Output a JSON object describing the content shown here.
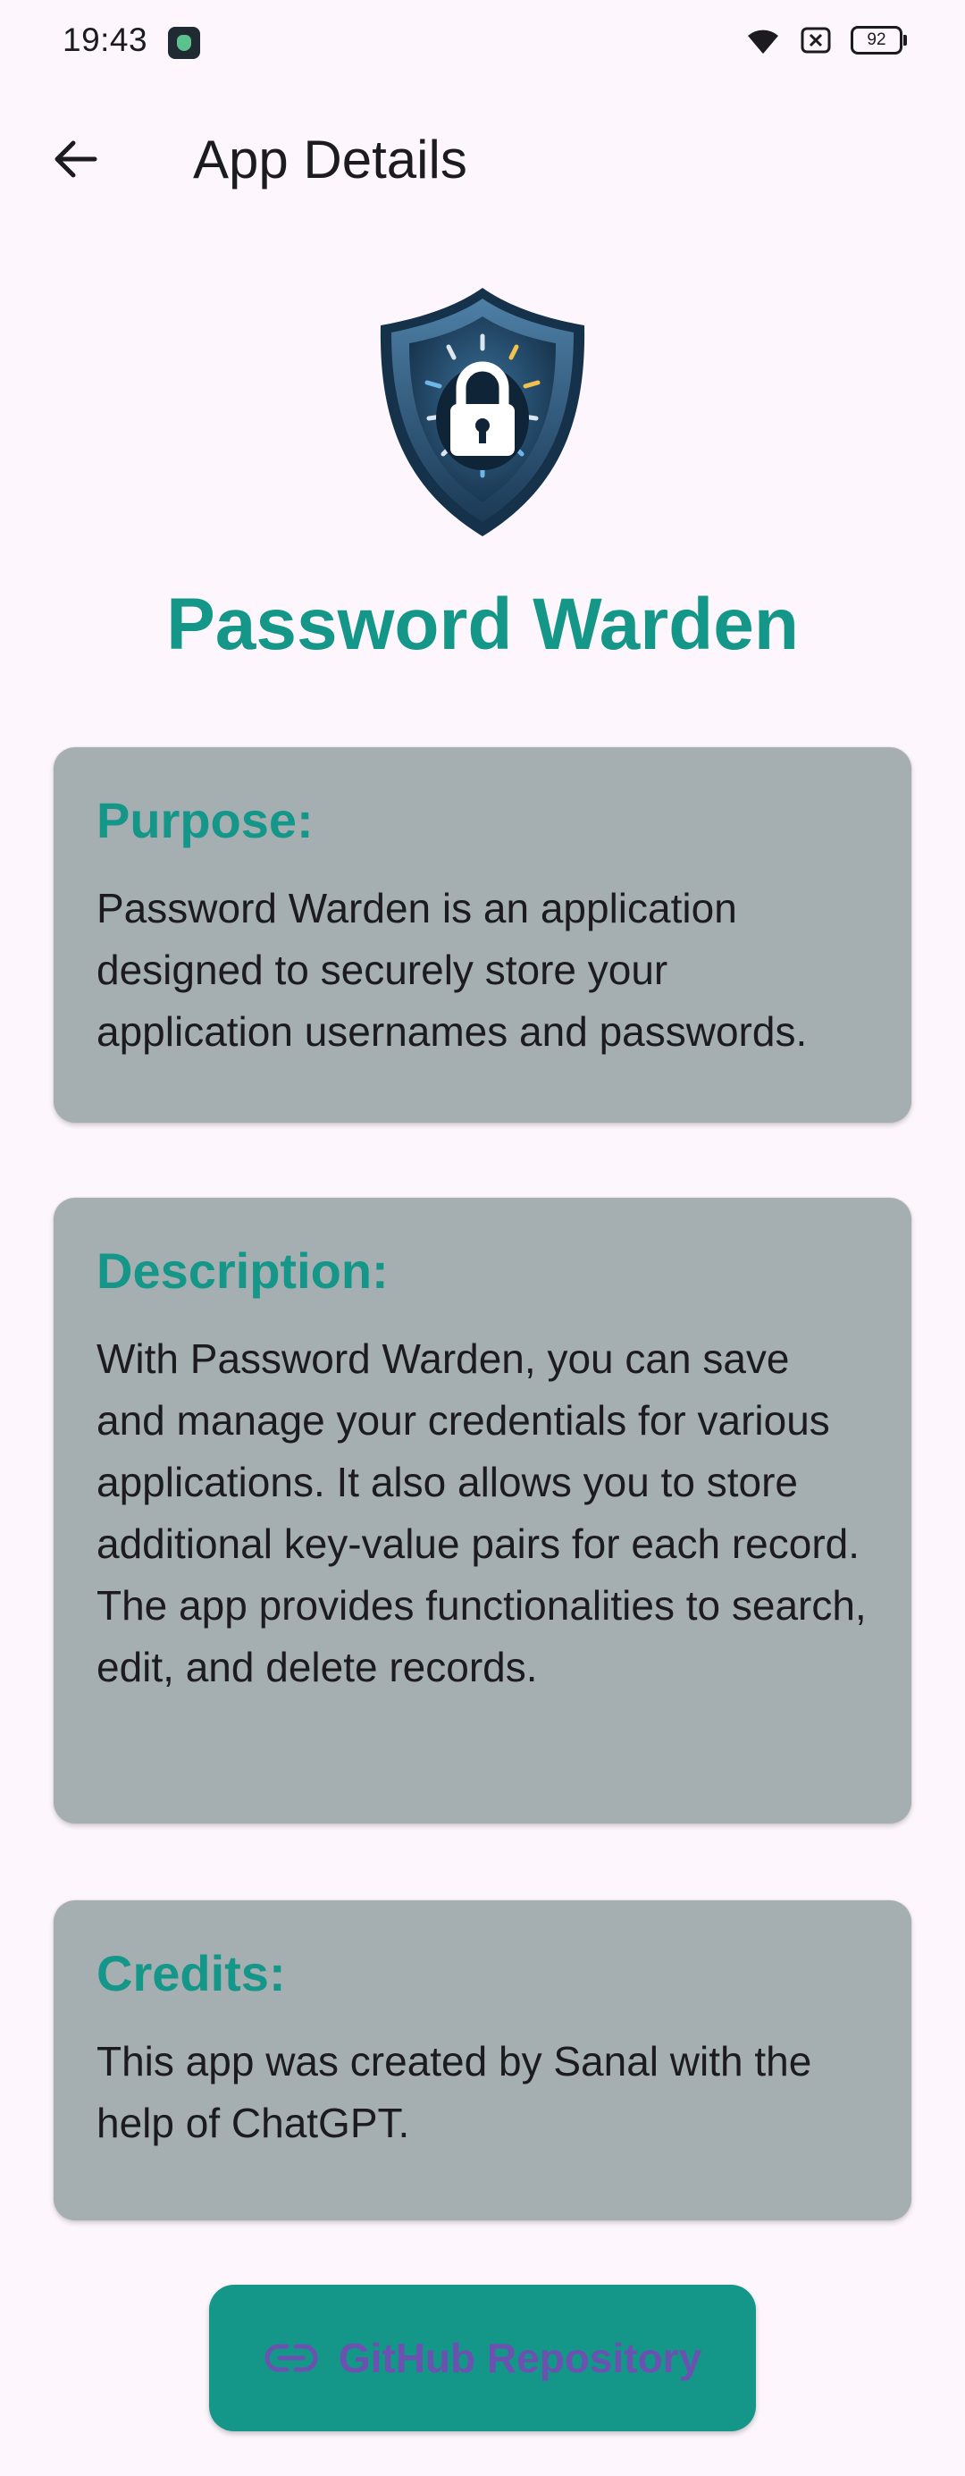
{
  "status_bar": {
    "time": "19:43",
    "battery": "92"
  },
  "app_bar": {
    "title": "App Details",
    "back_icon": "arrow-back-icon"
  },
  "logo": {
    "icon": "shield-lock-icon"
  },
  "app_name": "Password Warden",
  "sections": {
    "purpose": {
      "heading": "Purpose:",
      "body": "Password Warden is an application designed to securely store your application usernames and passwords."
    },
    "description": {
      "heading": "Description:",
      "body": "With Password Warden, you can save and manage your credentials for various applications. It also allows you to store additional key-value pairs for each record. The app provides functionalities to search, edit, and delete records."
    },
    "credits": {
      "heading": "Credits:",
      "body": "This app was created by Sanal with the help of ChatGPT."
    }
  },
  "github_button": {
    "label": "GitHub Repository",
    "icon": "link-icon"
  },
  "colors": {
    "background": "#FDF7FD",
    "accent": "#149688",
    "card": "#A5AFB2",
    "button_label": "#6B52B0"
  }
}
